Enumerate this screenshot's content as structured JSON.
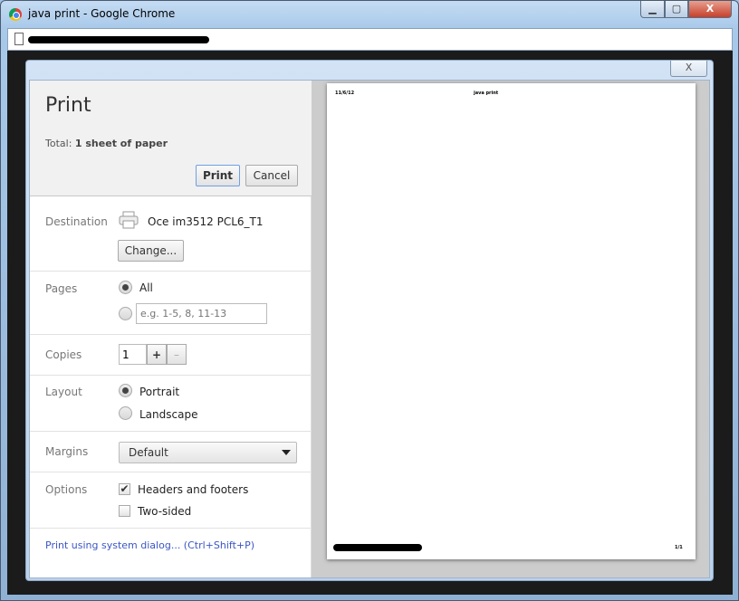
{
  "window": {
    "title": "java print - Google Chrome",
    "minimize": "▁",
    "maximize": "▢",
    "close": "X"
  },
  "dialog": {
    "close": "X"
  },
  "print": {
    "title": "Print",
    "total_label": "Total:",
    "total_value": "1 sheet of paper",
    "print_button": "Print",
    "cancel_button": "Cancel",
    "destination": {
      "label": "Destination",
      "printer": "Oce im3512 PCL6_T1",
      "change_button": "Change..."
    },
    "pages": {
      "label": "Pages",
      "all": "All",
      "all_selected": true,
      "range_placeholder": "e.g. 1-5, 8, 11-13"
    },
    "copies": {
      "label": "Copies",
      "value": "1",
      "plus": "+",
      "minus": "–"
    },
    "layout": {
      "label": "Layout",
      "portrait": "Portrait",
      "landscape": "Landscape",
      "selected": "Portrait"
    },
    "margins": {
      "label": "Margins",
      "value": "Default"
    },
    "options": {
      "label": "Options",
      "headers_footers": "Headers and footers",
      "headers_footers_checked": true,
      "two_sided": "Two-sided",
      "two_sided_checked": false
    },
    "system_dialog_link": "Print using system dialog... (Ctrl+Shift+P)"
  },
  "preview": {
    "header_date": "11/6/12",
    "header_title": "java print",
    "footer_page": "1/1"
  }
}
